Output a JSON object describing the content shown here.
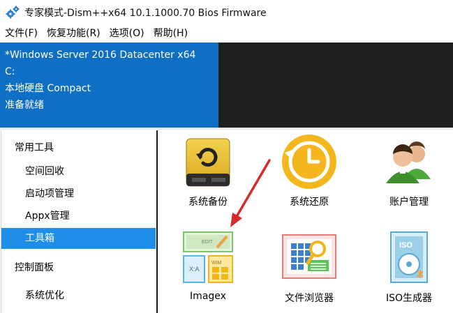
{
  "window": {
    "title": "专家模式-Dism++x64 10.1.1000.70 Bios Firmware"
  },
  "menu": [
    {
      "label": "文件(F)"
    },
    {
      "label": "恢复功能(R)"
    },
    {
      "label": "选项(O)"
    },
    {
      "label": "帮助(H)"
    }
  ],
  "info": {
    "os": "*Windows Server 2016 Datacenter x64",
    "drive": "C:",
    "disk": "本地硬盘 Compact",
    "status": "准备就绪"
  },
  "sidebar": {
    "groups": [
      {
        "label": "常用工具",
        "items": [
          {
            "label": "空间回收"
          },
          {
            "label": "启动项管理"
          },
          {
            "label": "Appx管理"
          },
          {
            "label": "工具箱",
            "active": true
          }
        ]
      },
      {
        "label": "控制面板",
        "items": [
          {
            "label": "系统优化"
          }
        ]
      }
    ]
  },
  "tools": [
    {
      "label": "系统备份",
      "icon": "backup-drive-icon"
    },
    {
      "label": "系统还原",
      "icon": "restore-clock-icon"
    },
    {
      "label": "账户管理",
      "icon": "users-icon"
    },
    {
      "label": "Imagex",
      "icon": "imagex-icon"
    },
    {
      "label": "文件浏览器",
      "icon": "file-explorer-icon"
    },
    {
      "label": "ISO生成器",
      "icon": "iso-disc-icon"
    }
  ],
  "colors": {
    "info_bg": "#0f6fc4",
    "dark_bg": "#1f1f1f",
    "active_item": "#1f8ee8",
    "arrow": "#d42a2a"
  }
}
